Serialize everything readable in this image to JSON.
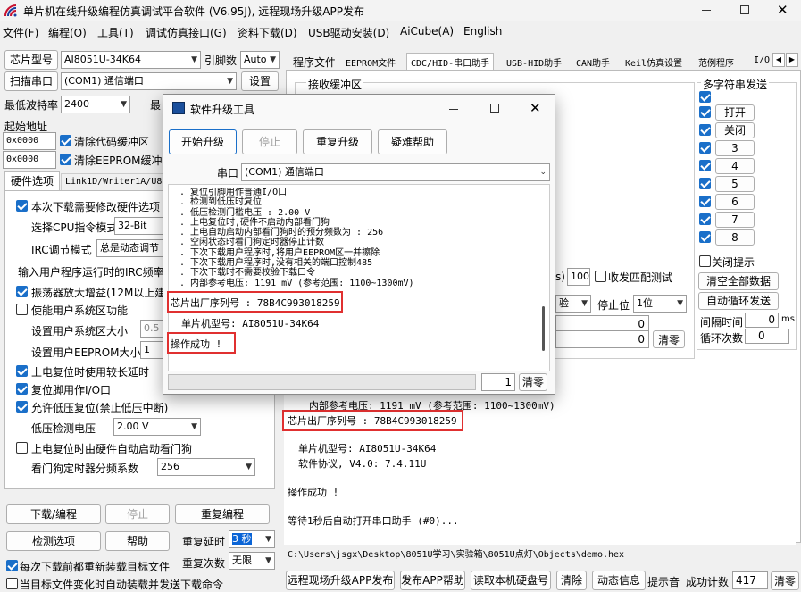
{
  "window": {
    "title": "单片机在线升级编程仿真调试平台软件 (V6.95J), 远程现场升级APP发布"
  },
  "menu": [
    "文件(F)",
    "编程(O)",
    "工具(T)",
    "调试仿真接口(G)",
    "资料下载(D)",
    "USB驱动安装(D)",
    "AiCube(A)",
    "English"
  ],
  "left": {
    "chip_label": "芯片型号",
    "chip_value": "AI8051U-34K64",
    "pin_label": "引脚数",
    "pin_value": "Auto",
    "scan_label": "扫描串口",
    "port_value": "(COM1) 通信端口",
    "settings_label": "设置",
    "min_baud_label": "最低波特率",
    "min_baud_value": "2400",
    "max_baud_label": "最",
    "start_addr_label": "起始地址",
    "addr1": "0x0000",
    "addr2": "0x0000",
    "clear_code_label": "清除代码缓冲区",
    "clear_eeprom_label": "清除EEPROM缓冲区",
    "tabs": [
      "硬件选项",
      "Link1D/Writer1A/U8"
    ],
    "opt_modify": "本次下载需要修改硬件选项",
    "cpu_mode_label": "选择CPU指令模式",
    "cpu_mode_value": "32-Bit",
    "irc_label": "IRC调节模式",
    "irc_value": "总是动态调节",
    "irc_input_label": "输入用户程序运行时的IRC频率",
    "osc_amp": "振荡器放大增益(12M以上建议",
    "user_sys": "使能用户系统区功能",
    "user_sys_size": "设置用户系统区大小",
    "user_sys_val": "0.5",
    "eeprom_size": "设置用户EEPROM大小",
    "eeprom_val": "1",
    "long_delay": "上电复位时使用较长延时",
    "reset_io": "复位脚用作I/O口",
    "low_volt": "允许低压复位(禁止低压中断)",
    "lv_detect_label": "低压检测电压",
    "lv_detect_value": "2.00 V",
    "wdt_auto": "上电复位时由硬件自动启动看门狗",
    "wdt_div_label": "看门狗定时器分频系数",
    "wdt_div_value": "256",
    "download_btn": "下载/编程",
    "stop_btn": "停止",
    "reprog_btn": "重复编程",
    "check_btn": "检测选项",
    "help_btn": "帮助",
    "repeat_delay_label": "重复延时",
    "repeat_delay_value": "3 秒",
    "repeat_count_label": "重复次数",
    "repeat_count_value": "无限",
    "reload_each": "每次下载前都重新装载目标文件",
    "auto_reload": "当目标文件变化时自动装载并发送下载命令"
  },
  "right": {
    "tabs": [
      "程序文件",
      "EEPROM文件",
      "CDC/HID-串口助手",
      "USB-HID助手",
      "CAN助手",
      "Keil仿真设置",
      "范例程序",
      "I/O"
    ],
    "recv_label": "接收缓冲区",
    "multi_send_label": "多字符串发送",
    "ms_items": [
      "打开",
      "关闭",
      "3",
      "4",
      "5",
      "6",
      "7",
      "8"
    ],
    "close_hint": "关闭提示",
    "clear_all": "清空全部数据",
    "auto_loop": "自动循环发送",
    "interval_label": "间隔时间",
    "interval_value": "0",
    "interval_unit": "ms",
    "loop_label": "循环次数",
    "loop_value": "0",
    "partial_s": "s)",
    "timeout_val": "100",
    "recv_match": "收发匹配测试",
    "parity_partial": "验",
    "stopbit_label": "停止位",
    "stopbit_value": "1位",
    "count1": "0",
    "count2": "0",
    "clear_btn": "清零",
    "log": [
      "内部参考电压: 1191 mV (参考范围: 1100~1300mV)",
      "芯片出厂序列号 : 78B4C993018259",
      "单片机型号: AI8051U-34K64",
      "软件协议, V4.0: 7.4.11U",
      "操作成功 !",
      "等待1秒后自动打开串口助手 (#0)..."
    ],
    "path": "C:\\Users\\jsgx\\Desktop\\8051U学习\\实验箱\\8051U点灯\\Objects\\demo.hex",
    "bottom_btns": [
      "远程现场升级APP发布",
      "发布APP帮助",
      "读取本机硬盘号",
      "清除",
      "动态信息"
    ],
    "sound_label": "提示音",
    "success_label": "成功计数",
    "success_value": "417",
    "clear2": "清零"
  },
  "dialog": {
    "title": "软件升级工具",
    "start_btn": "开始升级",
    "stop_btn": "停止",
    "repeat_btn": "重复升级",
    "help_btn": "疑难帮助",
    "port_label": "串口",
    "port_value": "(COM1) 通信端口",
    "log": [
      ". 复位引脚用作普通I/O口",
      ". 检测到低压时复位",
      ". 低压检测门槛电压 : 2.00 V",
      ". 上电复位时,硬件不启动内部看门狗",
      ". 上电自动启动内部看门狗时的预分频数为 : 256",
      ". 空闲状态时看门狗定时器停止计数",
      ". 下次下载用户程序时,将用户EEPROM区一并擦除",
      ". 下次下载用户程序时,没有相关的端口控制485",
      ". 下次下载时不需要校验下载口令",
      ". 内部参考电压: 1191 mV (参考范围: 1100~1300mV)"
    ],
    "serial": "芯片出厂序列号 : 78B4C993018259",
    "model": "单片机型号: AI8051U-34K64",
    "success": "操作成功 !",
    "count_value": "1",
    "clear_btn": "清零"
  }
}
